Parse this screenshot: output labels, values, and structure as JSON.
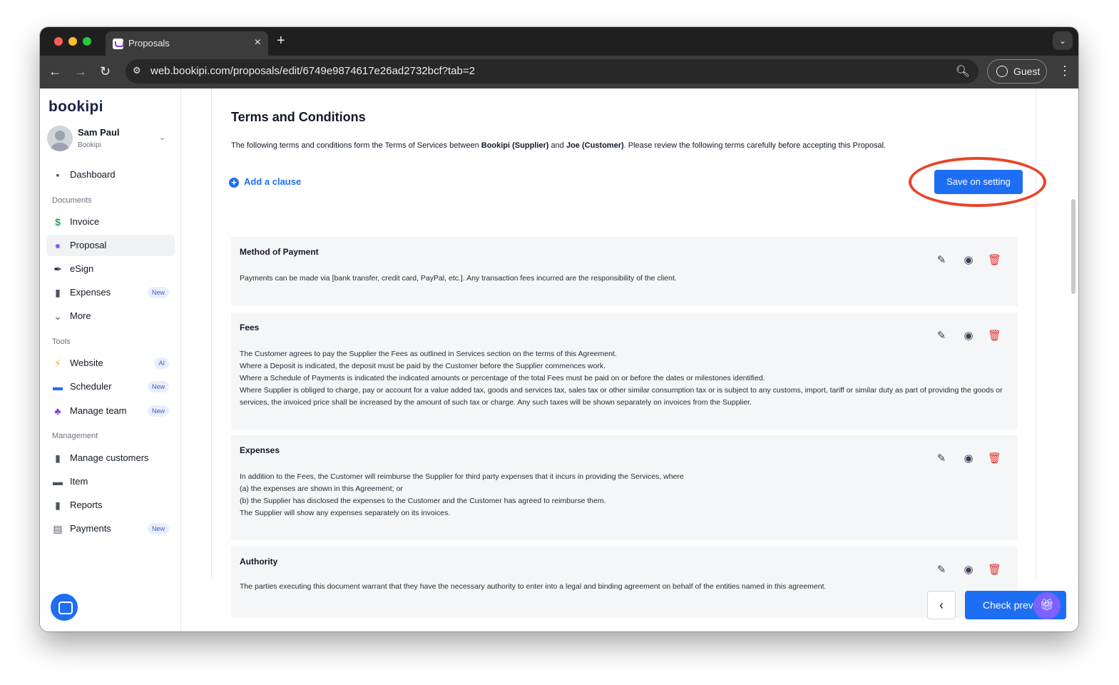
{
  "browser": {
    "tab_title": "Proposals",
    "tab_close": "×",
    "new_tab": "+",
    "url": "web.bookipi.com/proposals/edit/6749e9874617e26ad2732bcf?tab=2",
    "profile_label": "Guest",
    "tab_menu_glyph": "⌄",
    "back_glyph": "←",
    "forward_glyph": "→",
    "reload_glyph": "↻",
    "kebab_glyph": "⋮"
  },
  "sidebar": {
    "logo": "bookipi",
    "user": {
      "name": "Sam Paul",
      "org": "Bookipi"
    },
    "top_items": [
      {
        "label": "Dashboard",
        "icon": "grid-icon"
      }
    ],
    "documents_title": "Documents",
    "documents": [
      {
        "label": "Invoice",
        "icon": "dollar-icon"
      },
      {
        "label": "Proposal",
        "icon": "bulb-icon",
        "active": true
      },
      {
        "label": "eSign",
        "icon": "pen-icon"
      },
      {
        "label": "Expenses",
        "icon": "receipt-icon",
        "badge": "New"
      },
      {
        "label": "More",
        "icon": "chevron-down-icon"
      }
    ],
    "tools_title": "Tools",
    "tools": [
      {
        "label": "Website",
        "icon": "bolt-icon",
        "badge": "AI"
      },
      {
        "label": "Scheduler",
        "icon": "calendar-icon",
        "badge": "New"
      },
      {
        "label": "Manage team",
        "icon": "team-icon",
        "badge": "New"
      }
    ],
    "management_title": "Management",
    "management": [
      {
        "label": "Manage customers",
        "icon": "customers-icon"
      },
      {
        "label": "Item",
        "icon": "box-icon"
      },
      {
        "label": "Reports",
        "icon": "bar-chart-icon"
      },
      {
        "label": "Payments",
        "icon": "clipboard-icon",
        "badge": "New"
      }
    ]
  },
  "main": {
    "title": "Terms and Conditions",
    "intro": {
      "pre": "The following terms and conditions form the Terms of Services between ",
      "supplier": "Bookipi (Supplier)",
      "mid": " and ",
      "customer": "Joe (Customer)",
      "post": ". Please review the following terms carefully before accepting this Proposal."
    },
    "add_clause_label": "Add a clause",
    "save_button_label": "Save on setting",
    "clauses": [
      {
        "title": "Method of Payment",
        "body": "Payments can be made via [bank transfer, credit card, PayPal, etc.]. Any transaction fees incurred are the responsibility of the client."
      },
      {
        "title": "Fees",
        "body": "The Customer agrees to pay the Supplier the Fees as outlined in Services section on the terms of this Agreement.\nWhere a Deposit is indicated, the deposit must be paid by the Customer before the Supplier commences work.\nWhere a Schedule of Payments is indicated the indicated amounts or percentage of the total Fees must be paid on or before the dates or milestones identified.\nWhere Supplier is obliged to charge, pay or account for a value added tax, goods and services tax, sales tax or other similar consumption tax or is subject to any customs, import, tariff or similar duty as part of providing the goods or services, the invoiced price shall be increased by the amount of such tax or charge. Any such taxes will be shown separately on invoices from the Supplier."
      },
      {
        "title": "Expenses",
        "body": "In addition to the Fees, the Customer will reimburse the Supplier for third party expenses that it incurs in providing the Services, where\n(a) the expenses are shown in this Agreement; or\n(b) the Supplier has disclosed the expenses to the Customer and the Customer has agreed to reimburse them.\nThe Supplier will show any expenses separately on its invoices."
      },
      {
        "title": "Authority",
        "body": "The parties executing this document warrant that they have the necessary authority to enter into a legal and binding agreement on behalf of the entities named in this agreement."
      }
    ],
    "footer": {
      "back_glyph": "‹",
      "preview_label": "Check prev"
    }
  },
  "colors": {
    "accent": "#1e6ef4",
    "highlight": "#e8442b",
    "delete": "#e03131"
  }
}
